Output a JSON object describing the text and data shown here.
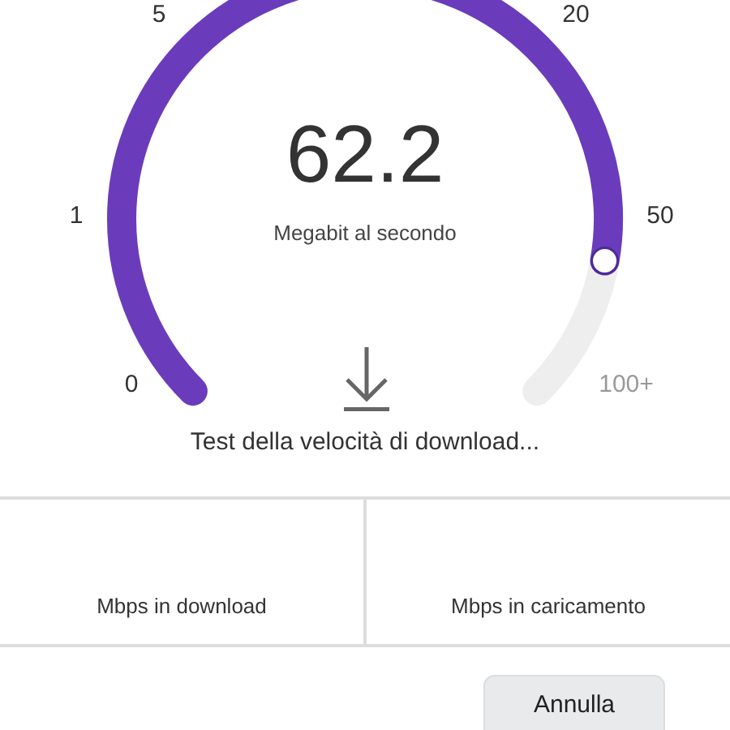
{
  "gauge": {
    "value": "62.2",
    "unit": "Megabit al secondo",
    "ticks": [
      "0",
      "1",
      "5",
      "20",
      "50",
      "100+"
    ],
    "status": "Test della velocità di download..."
  },
  "results": [
    {
      "label": "Mbps in download"
    },
    {
      "label": "Mbps in caricamento"
    }
  ],
  "buttons": [
    "Annulla"
  ]
}
